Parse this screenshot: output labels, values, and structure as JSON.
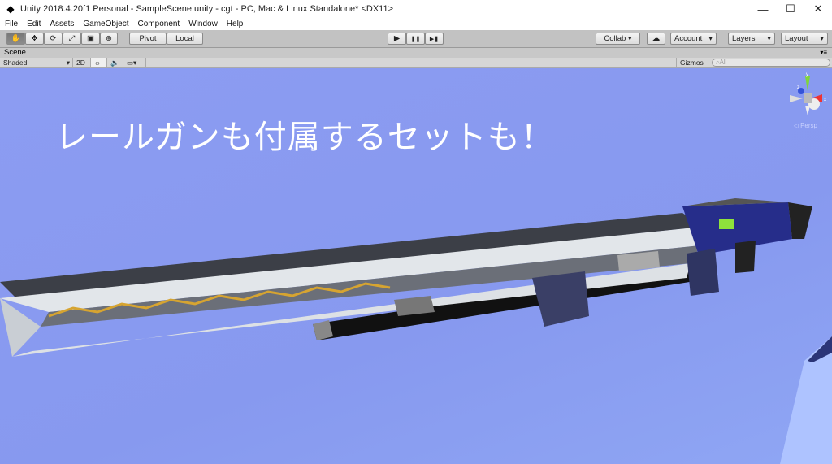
{
  "window": {
    "title": "Unity 2018.4.20f1 Personal - SampleScene.unity - cgt - PC, Mac & Linux Standalone* <DX11>",
    "controls": [
      "—",
      "☐",
      "✕"
    ]
  },
  "menu": [
    "File",
    "Edit",
    "Assets",
    "GameObject",
    "Component",
    "Window",
    "Help"
  ],
  "toolbar": {
    "tools": [
      "✋",
      "✥",
      "⟳",
      "⤢",
      "▣",
      "⊕"
    ],
    "pivot": "Pivot",
    "local": "Local",
    "play": "▶",
    "pause": "❚❚",
    "step": "▶❚",
    "collab": "Collab ▾",
    "cloud": "☁",
    "account": "Account",
    "layers": "Layers",
    "layout": "Layout"
  },
  "scene": {
    "tab": "Scene",
    "shading": "Shaded",
    "mode2d": "2D",
    "gizmos": "Gizmos",
    "search_placeholder": "All",
    "persp": "Persp",
    "overlay_text": "レールガンも付属するセットも！",
    "gizmo_labels": {
      "x": "x",
      "y": "y",
      "z": "z"
    }
  }
}
